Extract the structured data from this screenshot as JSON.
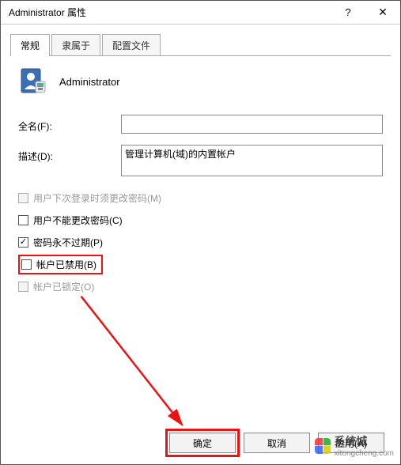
{
  "window": {
    "title": "Administrator 属性"
  },
  "tabs": [
    {
      "label": "常规",
      "active": true
    },
    {
      "label": "隶属于",
      "active": false
    },
    {
      "label": "配置文件",
      "active": false
    }
  ],
  "account": {
    "name": "Administrator"
  },
  "fields": {
    "fullname_label": "全名(F):",
    "fullname_value": "",
    "description_label": "描述(D):",
    "description_value": "管理计算机(域)的内置帐户"
  },
  "checkboxes": {
    "mustchange": {
      "label": "用户下次登录时须更改密码(M)",
      "checked": false,
      "enabled": false
    },
    "cantchange": {
      "label": "用户不能更改密码(C)",
      "checked": false,
      "enabled": true
    },
    "neverexpire": {
      "label": "密码永不过期(P)",
      "checked": true,
      "enabled": true
    },
    "disabled": {
      "label": "帐户已禁用(B)",
      "checked": false,
      "enabled": true
    },
    "locked": {
      "label": "帐户已锁定(O)",
      "checked": false,
      "enabled": false
    }
  },
  "buttons": {
    "ok": "确定",
    "cancel": "取消",
    "apply": "应用(A)"
  },
  "annotations": {
    "highlight_checkbox": "disabled",
    "highlight_button": "ok",
    "arrow_color": "#e11"
  },
  "watermark": {
    "text_main": "系统城",
    "text_sub": "xitongcheng.com"
  }
}
